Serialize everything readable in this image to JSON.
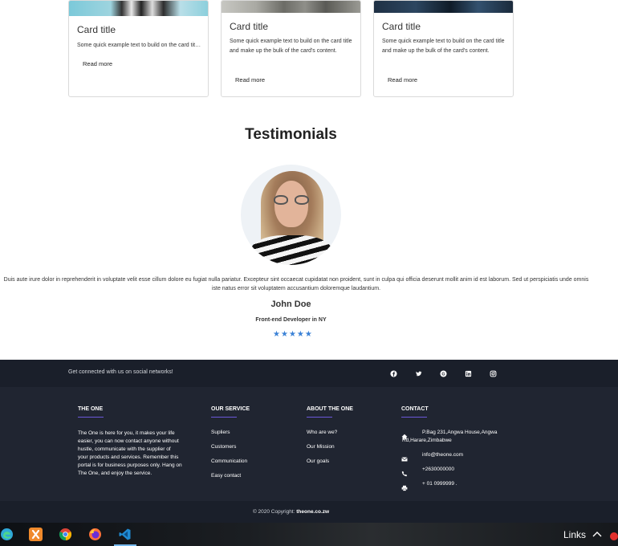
{
  "cards": [
    {
      "title": "Card title",
      "text": "Some quick example text to build on the card title and make up the bulk of the card's content.",
      "link": "Read more"
    },
    {
      "title": "Card title",
      "text": "Some quick example text to build on the card title and make up the bulk of the card's content.",
      "link": "Read more"
    },
    {
      "title": "Card title",
      "text": "Some quick example text to build on the card title and make up the bulk of the card's content.",
      "link": "Read more"
    }
  ],
  "testimonials": {
    "heading": "Testimonials",
    "quote": "Duis aute irure dolor in reprehenderit in voluptate velit esse cillum dolore eu fugiat nulla pariatur. Excepteur sint occaecat cupidatat non proident, sunt in culpa qui officia deserunt mollit anim id est laborum. Sed ut perspiciatis unde omnis iste natus error sit voluptatem accusantium doloremque laudantium.",
    "name": "John Doe",
    "role": "Front-end Developer in NY",
    "rating": 5,
    "star_color": "#3b82d6"
  },
  "footer": {
    "social_text": "Get connected with us on social networks!",
    "social_icons": [
      "facebook-icon",
      "twitter-icon",
      "google-icon",
      "linkedin-icon",
      "instagram-icon"
    ],
    "columns": {
      "the_one": {
        "title": "THE ONE",
        "text": "The One is here for you, it makes your life easier, you can now contact anyone without hustle, communicate with the supplier of your products and services. Remember this portal is for business purposes only. Hang on The One, and enjoy the service."
      },
      "our_service": {
        "title": "OUR SERVICE",
        "links": [
          "Supliers",
          "Customers",
          "Communication",
          "Easy contact"
        ]
      },
      "about": {
        "title": "ABOUT THE ONE",
        "links": [
          "Who are we?",
          "Our Mission",
          "Our goals"
        ]
      },
      "contact": {
        "title": "CONTACT",
        "address": "P.Bag 231,Angwa House,Angwa Rd,Harare,Zimbabwe",
        "email": "info@theone.com",
        "phone": "+2630000000",
        "fax": "+ 01 0999999 ."
      }
    },
    "copyright_prefix": "© 2020 Copyright:",
    "copyright_site": "theone.co.zw",
    "accent_color": "#6b57d9"
  },
  "taskbar": {
    "apps": [
      "edge-icon",
      "xampp-icon",
      "chrome-icon",
      "firefox-icon",
      "vscode-icon"
    ],
    "links_label": "Links"
  }
}
